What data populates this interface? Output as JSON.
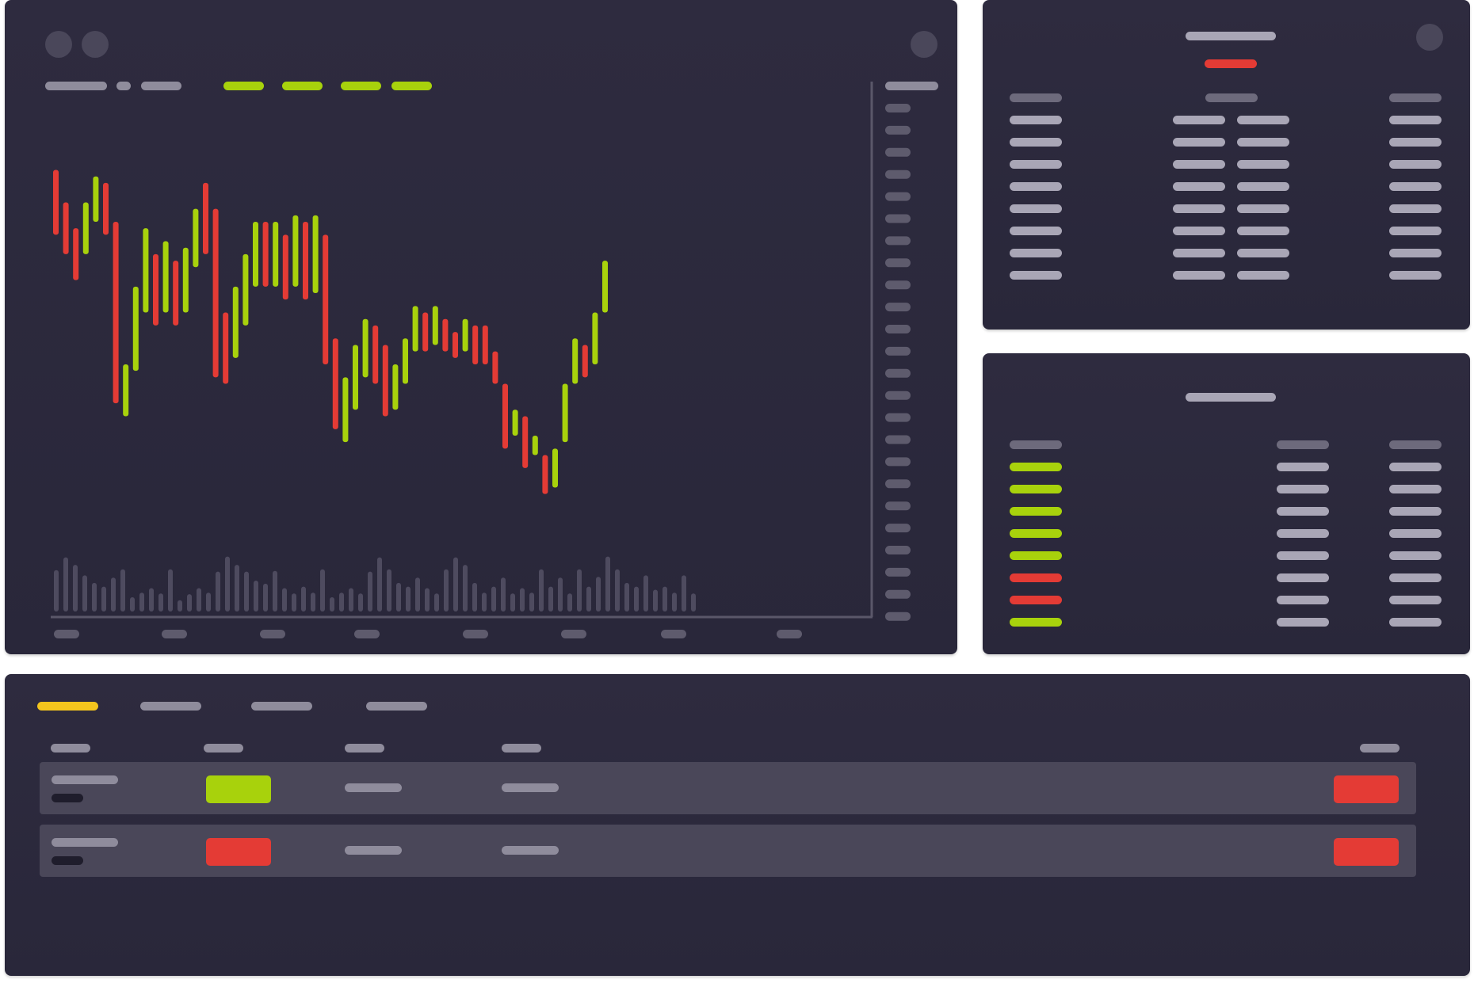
{
  "theme": {
    "panel_bg": "#2d2a3e",
    "bullish_color": "#a8d20c",
    "bearish_color": "#e43b35",
    "active_tab_color": "#f4c51d",
    "volume_color": "#4e4b5f",
    "axis_color": "#5a5769"
  },
  "chart_window": {
    "window_controls": [
      "window-dot",
      "window-dot"
    ],
    "settings_icon": "settings-dot-icon",
    "toolbar_placeholders": [
      "label",
      "label",
      "label"
    ],
    "timeframe_tabs": [
      "tab",
      "tab",
      "tab",
      "tab"
    ],
    "price_axis_tick_count": 24,
    "time_axis_tick_count": 8
  },
  "chart_data": {
    "type": "candlestick",
    "candles": [
      {
        "dir": "down",
        "high": 820,
        "low": 720
      },
      {
        "dir": "down",
        "high": 770,
        "low": 690
      },
      {
        "dir": "down",
        "high": 730,
        "low": 650
      },
      {
        "dir": "up",
        "high": 770,
        "low": 690
      },
      {
        "dir": "up",
        "high": 810,
        "low": 740
      },
      {
        "dir": "down",
        "high": 800,
        "low": 720
      },
      {
        "dir": "down",
        "high": 740,
        "low": 460
      },
      {
        "dir": "up",
        "high": 520,
        "low": 440
      },
      {
        "dir": "up",
        "high": 640,
        "low": 510
      },
      {
        "dir": "up",
        "high": 730,
        "low": 600
      },
      {
        "dir": "down",
        "high": 690,
        "low": 580
      },
      {
        "dir": "up",
        "high": 710,
        "low": 600
      },
      {
        "dir": "down",
        "high": 680,
        "low": 580
      },
      {
        "dir": "up",
        "high": 700,
        "low": 600
      },
      {
        "dir": "up",
        "high": 760,
        "low": 670
      },
      {
        "dir": "down",
        "high": 800,
        "low": 690
      },
      {
        "dir": "down",
        "high": 760,
        "low": 500
      },
      {
        "dir": "down",
        "high": 600,
        "low": 490
      },
      {
        "dir": "up",
        "high": 640,
        "low": 530
      },
      {
        "dir": "up",
        "high": 690,
        "low": 580
      },
      {
        "dir": "up",
        "high": 740,
        "low": 640
      },
      {
        "dir": "down",
        "high": 740,
        "low": 640
      },
      {
        "dir": "up",
        "high": 740,
        "low": 640
      },
      {
        "dir": "down",
        "high": 720,
        "low": 620
      },
      {
        "dir": "up",
        "high": 750,
        "low": 640
      },
      {
        "dir": "down",
        "high": 740,
        "low": 620
      },
      {
        "dir": "up",
        "high": 750,
        "low": 630
      },
      {
        "dir": "down",
        "high": 720,
        "low": 520
      },
      {
        "dir": "down",
        "high": 560,
        "low": 420
      },
      {
        "dir": "up",
        "high": 500,
        "low": 400
      },
      {
        "dir": "up",
        "high": 550,
        "low": 450
      },
      {
        "dir": "up",
        "high": 590,
        "low": 500
      },
      {
        "dir": "down",
        "high": 580,
        "low": 490
      },
      {
        "dir": "down",
        "high": 550,
        "low": 440
      },
      {
        "dir": "up",
        "high": 520,
        "low": 450
      },
      {
        "dir": "up",
        "high": 560,
        "low": 490
      },
      {
        "dir": "up",
        "high": 610,
        "low": 540
      },
      {
        "dir": "down",
        "high": 600,
        "low": 540
      },
      {
        "dir": "up",
        "high": 610,
        "low": 550
      },
      {
        "dir": "down",
        "high": 590,
        "low": 540
      },
      {
        "dir": "down",
        "high": 570,
        "low": 530
      },
      {
        "dir": "up",
        "high": 590,
        "low": 540
      },
      {
        "dir": "down",
        "high": 580,
        "low": 520
      },
      {
        "dir": "down",
        "high": 580,
        "low": 520
      },
      {
        "dir": "down",
        "high": 540,
        "low": 490
      },
      {
        "dir": "down",
        "high": 490,
        "low": 390
      },
      {
        "dir": "up",
        "high": 450,
        "low": 410
      },
      {
        "dir": "down",
        "high": 440,
        "low": 360
      },
      {
        "dir": "up",
        "high": 410,
        "low": 380
      },
      {
        "dir": "down",
        "high": 380,
        "low": 320
      },
      {
        "dir": "up",
        "high": 390,
        "low": 330
      },
      {
        "dir": "up",
        "high": 490,
        "low": 400
      },
      {
        "dir": "up",
        "high": 560,
        "low": 490
      },
      {
        "dir": "down",
        "high": 550,
        "low": 500
      },
      {
        "dir": "up",
        "high": 600,
        "low": 520
      },
      {
        "dir": "up",
        "high": 680,
        "low": 600
      }
    ],
    "volumes": [
      55,
      72,
      62,
      48,
      38,
      33,
      45,
      56,
      19,
      25,
      31,
      24,
      56,
      15,
      23,
      31,
      25,
      53,
      73,
      62,
      53,
      41,
      37,
      54,
      31,
      24,
      33,
      25,
      56,
      19,
      25,
      31,
      24,
      53,
      72,
      56,
      38,
      33,
      45,
      31,
      24,
      56,
      72,
      62,
      38,
      25,
      33,
      45,
      24,
      31,
      25,
      56,
      33,
      45,
      24,
      56,
      33,
      46,
      73,
      56,
      38,
      33,
      48,
      29,
      33,
      25,
      48,
      24
    ],
    "price_range": [
      300,
      850
    ]
  },
  "orderbook": {
    "settings_icon": "settings-dot-icon",
    "title_placeholder": "title",
    "spread_indicator": "spread",
    "columns": [
      "col",
      "col",
      "col"
    ],
    "row_count": 8
  },
  "trades": {
    "title_placeholder": "title",
    "columns": [
      "col",
      "col",
      "col"
    ],
    "rows": [
      "buy",
      "buy",
      "buy",
      "buy",
      "buy",
      "sell",
      "sell",
      "buy"
    ]
  },
  "orders": {
    "tabs": [
      {
        "state": "active"
      },
      {
        "state": "inactive"
      },
      {
        "state": "inactive"
      },
      {
        "state": "inactive"
      }
    ],
    "columns": [
      "col",
      "col",
      "col",
      "col",
      "col"
    ],
    "rows": [
      {
        "side": "buy",
        "action": "cancel"
      },
      {
        "side": "sell",
        "action": "cancel"
      }
    ]
  }
}
